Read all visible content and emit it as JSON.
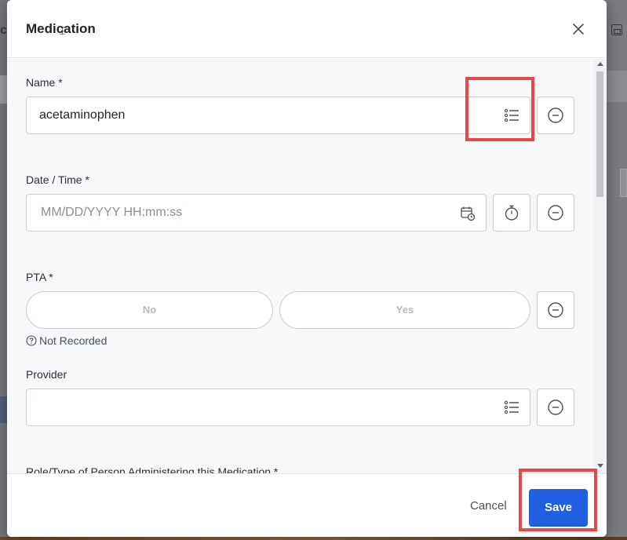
{
  "backdrop": {
    "left_text": "c"
  },
  "modal": {
    "title": "Medication",
    "close_icon": "close-icon"
  },
  "fields": {
    "name": {
      "label": "Name  *",
      "value": "acetaminophen",
      "list_icon": "list-icon",
      "remove_icon": "minus-circle-icon"
    },
    "datetime": {
      "label": "Date / Time  *",
      "placeholder": "MM/DD/YYYY HH:mm:ss",
      "calendar_icon": "calendar-clock-icon",
      "timer_icon": "stopwatch-icon",
      "remove_icon": "minus-circle-icon"
    },
    "pta": {
      "label": "PTA  *",
      "options": [
        "No",
        "Yes"
      ],
      "status": "Not Recorded",
      "status_icon": "question-circle-icon",
      "remove_icon": "minus-circle-icon"
    },
    "provider": {
      "label": "Provider",
      "value": "",
      "list_icon": "list-icon",
      "remove_icon": "minus-circle-icon"
    },
    "role": {
      "label": "Role/Type of Person Administering this Medication  *"
    }
  },
  "footer": {
    "cancel_label": "Cancel",
    "save_label": "Save"
  },
  "colors": {
    "primary": "#1f5fe0",
    "highlight": "#e8474b"
  }
}
